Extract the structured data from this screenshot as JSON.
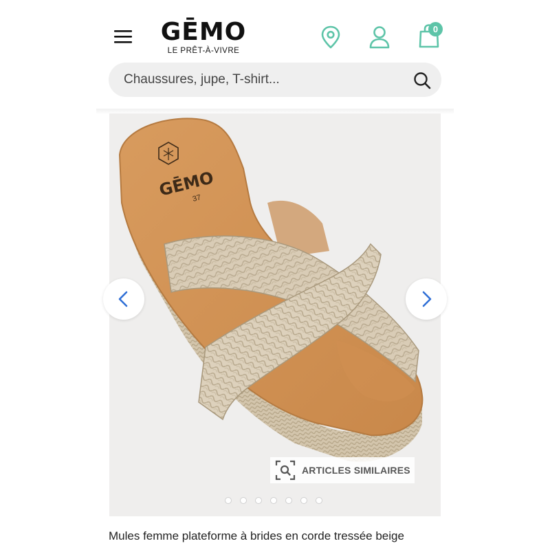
{
  "header": {
    "logo_text": "GĒMO",
    "logo_tagline": "LE PRÊT-À-VIVRE",
    "cart_count": "0"
  },
  "search": {
    "placeholder": "Chaussures, jupe, T-shirt..."
  },
  "product": {
    "image_logo_text": "GĒMO",
    "image_size_text": "37",
    "similar_articles_label": "ARTICLES SIMILAIRES",
    "carousel_dots": 7,
    "title": "Mules femme plateforme à brides en corde tressée beige"
  },
  "colors": {
    "accent": "#5dc4a8",
    "nav_arrow": "#2f6fd6"
  },
  "icons": {
    "menu": "hamburger-icon",
    "store": "location-pin-icon",
    "account": "user-icon",
    "cart": "shopping-bag-icon",
    "search": "search-icon",
    "prev": "chevron-left-icon",
    "next": "chevron-right-icon",
    "similar": "visual-search-icon"
  }
}
